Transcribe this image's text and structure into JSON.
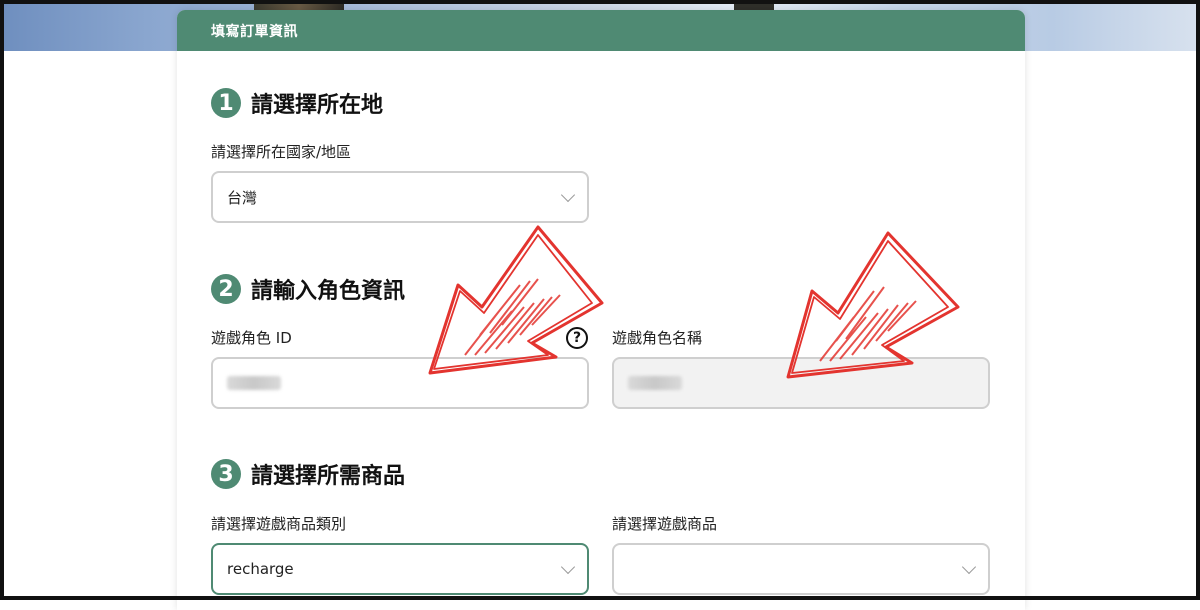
{
  "form": {
    "header_title": "填寫訂單資訊",
    "sections": [
      {
        "step": "1",
        "title": "請選擇所在地"
      },
      {
        "step": "2",
        "title": "請輸入角色資訊"
      },
      {
        "step": "3",
        "title": "請選擇所需商品"
      }
    ],
    "location": {
      "label": "請選擇所在國家/地區",
      "value": "台灣"
    },
    "character": {
      "id_label": "遊戲角色 ID",
      "help_symbol": "?",
      "name_label": "遊戲角色名稱"
    },
    "product": {
      "category_label": "請選擇遊戲商品類別",
      "category_value": "recharge",
      "item_label": "請選擇遊戲商品",
      "item_value": ""
    }
  },
  "annotation": {
    "arrow_color": "#e3342f"
  }
}
